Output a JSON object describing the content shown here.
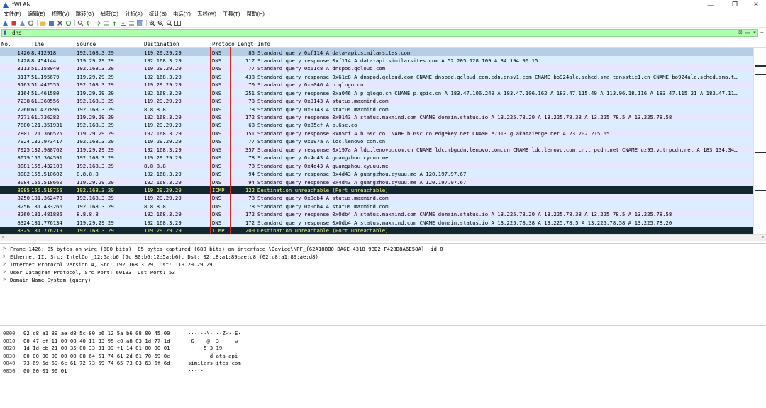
{
  "window": {
    "title": "*WLAN",
    "controls": {
      "minimize": "—",
      "maximize": "❐",
      "close": "✕"
    }
  },
  "menu": [
    "文件(F)",
    "编辑(E)",
    "视图(V)",
    "跳转(G)",
    "捕获(C)",
    "分析(A)",
    "统计(S)",
    "电话(Y)",
    "无线(W)",
    "工具(T)",
    "帮助(H)"
  ],
  "toolbar": {
    "icons": [
      "shark-fin-start-icon",
      "stop-icon",
      "restart-icon",
      "options-gear-icon",
      "open-folder-icon",
      "save-file-icon",
      "close-file-icon",
      "reload-icon",
      "find-icon",
      "back-arrow-icon",
      "forward-arrow-icon",
      "go-to-packet-icon",
      "first-packet-icon",
      "last-packet-icon",
      "autoscroll-icon",
      "colorize-icon",
      "zoom-in-icon",
      "zoom-out-icon",
      "zoom-reset-icon",
      "resize-columns-icon"
    ]
  },
  "filter": {
    "value": "dns",
    "colors": {
      "valid_bg": "#afffaf"
    }
  },
  "packet_list": {
    "columns": [
      "No.",
      "Time",
      "Source",
      "Destination",
      "Protoco",
      "Lengt",
      "Info"
    ],
    "rows": [
      {
        "no": "1426",
        "time": "8.412918",
        "src": "192.168.3.29",
        "dst": "119.29.29.29",
        "proto": "DNS",
        "len": "85",
        "info": "Standard query 0xf114 A data-api.similarsites.com",
        "state": "selected"
      },
      {
        "no": "1428",
        "time": "8.454144",
        "src": "119.29.29.29",
        "dst": "192.168.3.29",
        "proto": "DNS",
        "len": "117",
        "info": "Standard query response 0xf114 A data-api.similarsites.com A 52.205.128.109 A 34.194.96.15",
        "state": ""
      },
      {
        "no": "3113",
        "time": "51.158940",
        "src": "192.168.3.29",
        "dst": "119.29.29.29",
        "proto": "DNS",
        "len": "77",
        "info": "Standard query 0x61c8 A dnspod.qcloud.com",
        "state": ""
      },
      {
        "no": "3117",
        "time": "51.195679",
        "src": "119.29.29.29",
        "dst": "192.168.3.29",
        "proto": "DNS",
        "len": "438",
        "info": "Standard query response 0x61c8 A dnspod.qcloud.com CNAME dnspod.qcloud.com.cdn.dnsv1.com CNAME bo924alc.sched.sma.tdnsstic1.cn CNAME bo924alc.sched.sma.t…",
        "state": ""
      },
      {
        "no": "3163",
        "time": "51.442555",
        "src": "192.168.3.29",
        "dst": "119.29.29.29",
        "proto": "DNS",
        "len": "70",
        "info": "Standard query 0xa046 A p.qlogo.cn",
        "state": ""
      },
      {
        "no": "3164",
        "time": "51.461580",
        "src": "119.29.29.29",
        "dst": "192.168.3.29",
        "proto": "DNS",
        "len": "251",
        "info": "Standard query response 0xa046 A p.qlogo.cn CNAME p.qpic.cn A 183.47.106.249 A 183.47.106.162 A 183.47.115.49 A 113.96.18.116 A 183.47.115.21 A 183.47.11…",
        "state": ""
      },
      {
        "no": "7238",
        "time": "61.360556",
        "src": "192.168.3.29",
        "dst": "119.29.29.29",
        "proto": "DNS",
        "len": "78",
        "info": "Standard query 0x9143 A status.maxmind.com",
        "state": ""
      },
      {
        "no": "7260",
        "time": "61.427896",
        "src": "192.168.3.29",
        "dst": "8.8.8.8",
        "proto": "DNS",
        "len": "78",
        "info": "Standard query 0x9143 A status.maxmind.com",
        "state": ""
      },
      {
        "no": "7271",
        "time": "61.736282",
        "src": "119.29.29.29",
        "dst": "192.168.3.29",
        "proto": "DNS",
        "len": "172",
        "info": "Standard query response 0x9143 A status.maxmind.com CNAME domain.status.io A 13.225.78.20 A 13.225.78.38 A 13.225.78.5 A 13.225.78.58",
        "state": ""
      },
      {
        "no": "7800",
        "time": "121.351931",
        "src": "192.168.3.29",
        "dst": "119.29.29.29",
        "proto": "DNS",
        "len": "68",
        "info": "Standard query 0x85cf A b.6sc.co",
        "state": ""
      },
      {
        "no": "7801",
        "time": "121.366525",
        "src": "119.29.29.29",
        "dst": "192.168.3.29",
        "proto": "DNS",
        "len": "151",
        "info": "Standard query response 0x85cf A b.6sc.co CNAME b.6sc.co.edgekey.net CNAME e7313.g.akamaiedge.net A 23.202.215.65",
        "state": ""
      },
      {
        "no": "7924",
        "time": "132.973417",
        "src": "192.168.3.29",
        "dst": "119.29.29.29",
        "proto": "DNS",
        "len": "77",
        "info": "Standard query 0x197a A ldc.lenovo.com.cn",
        "state": ""
      },
      {
        "no": "7925",
        "time": "132.988762",
        "src": "119.29.29.29",
        "dst": "192.168.3.29",
        "proto": "DNS",
        "len": "357",
        "info": "Standard query response 0x197a A ldc.lenovo.com.cn CNAME ldc.mbgcdn.lenovo.com.cn CNAME ldc.lenovo.com.cn.trpcdn.net CNAME uz95.v.trpcdn.net A 183.134.34…",
        "state": ""
      },
      {
        "no": "8079",
        "time": "155.364591",
        "src": "192.168.3.29",
        "dst": "119.29.29.29",
        "proto": "DNS",
        "len": "78",
        "info": "Standard query 0x4d43 A guangzhou.cyuuu.me",
        "state": ""
      },
      {
        "no": "8081",
        "time": "155.432108",
        "src": "192.168.3.29",
        "dst": "8.8.8.8",
        "proto": "DNS",
        "len": "78",
        "info": "Standard query 0x4d43 A guangzhou.cyuuu.me",
        "state": ""
      },
      {
        "no": "8082",
        "time": "155.510602",
        "src": "8.8.8.8",
        "dst": "192.168.3.29",
        "proto": "DNS",
        "len": "94",
        "info": "Standard query response 0x4d43 A guangzhou.cyuuu.me A 120.197.97.67",
        "state": ""
      },
      {
        "no": "8084",
        "time": "155.518660",
        "src": "119.29.29.29",
        "dst": "192.168.3.29",
        "proto": "DNS",
        "len": "94",
        "info": "Standard query response 0x4d43 A guangzhou.cyuuu.me A 120.197.97.67",
        "state": ""
      },
      {
        "no": "8085",
        "time": "155.518755",
        "src": "192.168.3.29",
        "dst": "119.29.29.29",
        "proto": "ICMP",
        "len": "122",
        "info": "Destination unreachable (Port unreachable)",
        "state": "icmp"
      },
      {
        "no": "8250",
        "time": "181.362478",
        "src": "192.168.3.29",
        "dst": "119.29.29.29",
        "proto": "DNS",
        "len": "78",
        "info": "Standard query 0x0db4 A status.maxmind.com",
        "state": ""
      },
      {
        "no": "8256",
        "time": "181.433266",
        "src": "192.168.3.29",
        "dst": "8.8.8.8",
        "proto": "DNS",
        "len": "78",
        "info": "Standard query 0x0db4 A status.maxmind.com",
        "state": ""
      },
      {
        "no": "8260",
        "time": "181.481886",
        "src": "8.8.8.8",
        "dst": "192.168.3.29",
        "proto": "DNS",
        "len": "172",
        "info": "Standard query response 0x0db4 A status.maxmind.com CNAME domain.status.io A 13.225.78.20 A 13.225.78.38 A 13.225.78.5 A 13.225.78.58",
        "state": ""
      },
      {
        "no": "8324",
        "time": "181.776134",
        "src": "119.29.29.29",
        "dst": "192.168.3.29",
        "proto": "DNS",
        "len": "172",
        "info": "Standard query response 0x0db4 A status.maxmind.com CNAME domain.status.io A 13.225.78.38 A 13.225.78.5 A 13.225.78.58 A 13.225.78.20",
        "state": ""
      },
      {
        "no": "8325",
        "time": "181.776219",
        "src": "192.168.3.29",
        "dst": "119.29.29.29",
        "proto": "ICMP",
        "len": "200",
        "info": "Destination unreachable (Port unreachable)",
        "state": "icmp"
      }
    ]
  },
  "details": [
    "Frame 1426: 85 bytes on wire (680 bits), 85 bytes captured (680 bits) on interface \\Device\\NPF_{62A18BB0-BA6E-4318-9BD2-F428D8A6E58A}, id 0",
    "Ethernet II, Src: IntelCor_12:5a:b6 (5c:80:b6:12:5a:b6), Dst: 02:c8:a1:89:ae:d8 (02:c8:a1:89:ae:d8)",
    "Internet Protocol Version 4, Src: 192.168.3.29, Dst: 119.29.29.29",
    "User Datagram Protocol, Src Port: 60193, Dst Port: 53",
    "Domain Name System (query)"
  ],
  "bytes": [
    {
      "off": "0000",
      "hex": "02 c8 a1 89 ae d8 5c 80  b6 12 5a b6 08 00 45 00",
      "ascii": "······\\· ··Z···E·"
    },
    {
      "off": "0010",
      "hex": "00 47 ef 11 00 00 40 11  33 95 c0 a8 03 1d 77 1d",
      "ascii": "·G····@· 3·····w·"
    },
    {
      "off": "0020",
      "hex": "1d 1d eb 21 00 35 00 33  31 39 f1 14 01 00 00 01",
      "ascii": "···!·5·3 19······"
    },
    {
      "off": "0030",
      "hex": "00 00 00 00 00 00 08 64  61 74 61 2d 61 70 69 0c",
      "ascii": "·······d ata-api·"
    },
    {
      "off": "0040",
      "hex": "73 69 6d 69 6c 61 72 73  69 74 65 73 03 63 6f 6d",
      "ascii": "similars ites·com"
    },
    {
      "off": "0050",
      "hex": "00 00 01 00 01",
      "ascii": "·····"
    }
  ],
  "colors": {
    "row_odd": "#e7e6ff",
    "row_even": "#daeeff",
    "row_selected": "#b7cde6",
    "icmp_bg": "#12272e",
    "icmp_fg": "#f7f787",
    "highlight_box": "#e0201d"
  }
}
